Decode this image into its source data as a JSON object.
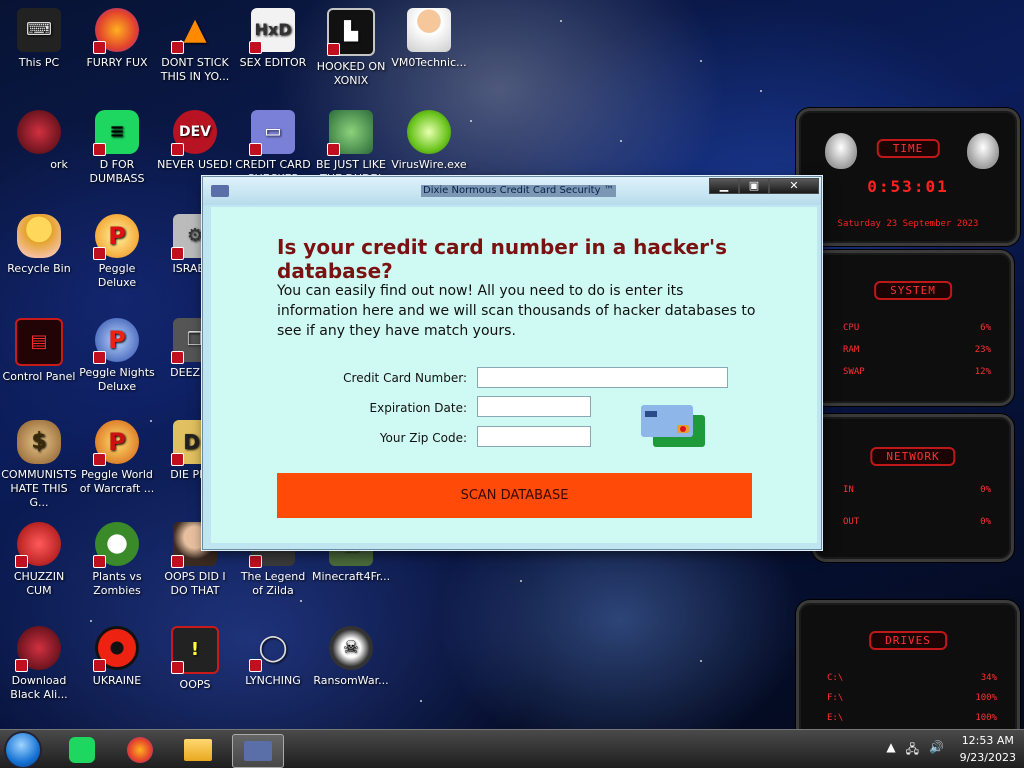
{
  "desktop_icons": [
    {
      "label": "This PC"
    },
    {
      "label": "FURRY FUX"
    },
    {
      "label": "DONT STICK THIS IN YO..."
    },
    {
      "label": "SEX EDITOR"
    },
    {
      "label": "HOOKED ON XONIX"
    },
    {
      "label": "VM0Technic..."
    },
    {
      "label": "ork"
    },
    {
      "label": "D FOR DUMBASS"
    },
    {
      "label": "NEVER USED!"
    },
    {
      "label": "CREDIT CARD CHECKER"
    },
    {
      "label": "BE JUST LIKE THE DUDE!"
    },
    {
      "label": "VirusWire.exe"
    },
    {
      "label": "Recycle Bin"
    },
    {
      "label": "Peggle Deluxe"
    },
    {
      "label": "ISRAELS"
    },
    {
      "label": "Control Panel"
    },
    {
      "label": "Peggle Nights Deluxe"
    },
    {
      "label": "DEEZ NU"
    },
    {
      "label": "COMMUNISTS HATE THIS G..."
    },
    {
      "label": "Peggle World of Warcraft ..."
    },
    {
      "label": "DIE PLEA"
    },
    {
      "label": "CHUZZIN CUM"
    },
    {
      "label": "Plants vs Zombies"
    },
    {
      "label": "OOPS DID I DO THAT"
    },
    {
      "label": "The Legend of Zilda"
    },
    {
      "label": "Minecraft4Fr..."
    },
    {
      "label": "Download Black Ali..."
    },
    {
      "label": "UKRAINE"
    },
    {
      "label": "OOPS"
    },
    {
      "label": "LYNCHING"
    },
    {
      "label": "RansomWar..."
    }
  ],
  "dialog": {
    "title": "Dixie Normous Credit Card Security ™",
    "headline": "Is your credit card number in a hacker's database?",
    "description": "You can easily find out now! All you need to do is enter its information here and we will scan thousands of hacker databases to see if any they have match yours.",
    "fields": {
      "card_number_label": "Credit Card Number:",
      "card_number_value": "",
      "expiration_label": "Expiration Date:",
      "expiration_value": "",
      "zip_label": "Your Zip Code:",
      "zip_value": ""
    },
    "scan_button": "SCAN DATABASE",
    "minimize_glyph": "▁",
    "maximize_glyph": "▣",
    "close_glyph": "✕"
  },
  "widgets": {
    "time": {
      "title": "TIME",
      "clock": "0:53:01",
      "date": "Saturday 23 September 2023"
    },
    "system": {
      "title": "SYSTEM",
      "rows": [
        {
          "name": "CPU",
          "value": "6%"
        },
        {
          "name": "RAM",
          "value": "23%"
        },
        {
          "name": "SWAP",
          "value": "12%"
        }
      ]
    },
    "network": {
      "title": "NETWORK",
      "rows": [
        {
          "name": "IN",
          "value": "0%"
        },
        {
          "name": "OUT",
          "value": "0%"
        }
      ]
    },
    "drives": {
      "title": "DRIVES",
      "rows": [
        {
          "name": "C:\\",
          "value": "34%"
        },
        {
          "name": "F:\\",
          "value": "100%"
        },
        {
          "name": "E:\\",
          "value": "100%"
        }
      ]
    }
  },
  "taskbar": {
    "time": "12:53 AM",
    "date": "9/23/2023"
  },
  "colors": {
    "scan_button": "#ff4a08",
    "headline": "#7a1212",
    "dialog_bg": "#cffaf3",
    "widget_accent": "#ff2a2a"
  }
}
